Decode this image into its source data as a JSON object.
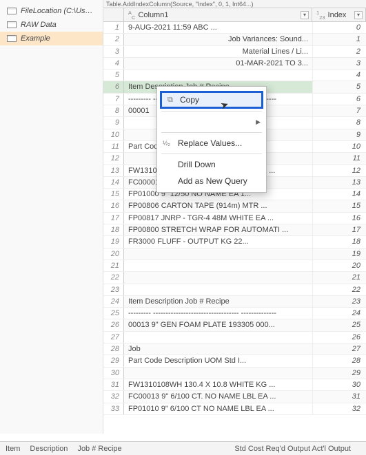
{
  "nav": {
    "items": [
      {
        "label": "FileLocation (C:\\Users\\lisde..."
      },
      {
        "label": "RAW Data"
      },
      {
        "label": "Example"
      }
    ]
  },
  "fx": "Table.AddIndexColumn(Source, \"Index\", 0, 1, Int64...)",
  "columns": {
    "col1": {
      "type_prefix": "A",
      "type_suffix": "C",
      "label": "Column1"
    },
    "col2": {
      "type_prefix": "1",
      "type_suffix": "23",
      "label": "Index"
    }
  },
  "rows": [
    {
      "n": 1,
      "c1": "9-AUG-2021 11:59                                   ABC ...",
      "idx": 0
    },
    {
      "n": 2,
      "c1": "Job Variances: Sound...",
      "idx": 1,
      "align": "right"
    },
    {
      "n": 3,
      "c1": "Material Lines / Li...",
      "idx": 2,
      "align": "right"
    },
    {
      "n": 4,
      "c1": "01-MAR-2021 TO 3...",
      "idx": 3,
      "align": "right"
    },
    {
      "n": 5,
      "c1": "",
      "idx": 4
    },
    {
      "n": 6,
      "c1": "Item       Description            Job #  Recipe",
      "idx": 5
    },
    {
      "n": 7,
      "c1": "---------   ----------------------------------   --------------",
      "idx": 6
    },
    {
      "n": 8,
      "c1": "00001",
      "idx": 7
    },
    {
      "n": 9,
      "c1": "",
      "idx": 8
    },
    {
      "n": 10,
      "c1": "",
      "idx": 9
    },
    {
      "n": 11,
      "c1": "   Part Code",
      "idx": 10
    },
    {
      "n": 12,
      "c1": "",
      "idx": 11
    },
    {
      "n": 13,
      "c1": "   FW1310108WH  130.4 X 10.8        WHITE KG   ...",
      "idx": 12
    },
    {
      "n": 14,
      "c1": "   FC00001      9\" 12/50 CT. NO NAME      EA",
      "idx": 13
    },
    {
      "n": 15,
      "c1": "   FP01000      9\" 12/50 NO NAME          EA     1...",
      "idx": 14
    },
    {
      "n": 16,
      "c1": "   FP00806      CARTON TAPE (914m)        MTR   ...",
      "idx": 15
    },
    {
      "n": 17,
      "c1": "   FP00817      JNRP - TGR-4 48M WHITE    EA    ...",
      "idx": 16
    },
    {
      "n": 18,
      "c1": "   FP00800      STRETCH WRAP FOR AUTOMATI ...",
      "idx": 17
    },
    {
      "n": 19,
      "c1": "   FR3000       FLUFF - OUTPUT            KG     22...",
      "idx": 18
    },
    {
      "n": 20,
      "c1": "",
      "idx": 19
    },
    {
      "n": 21,
      "c1": "",
      "idx": 20
    },
    {
      "n": 22,
      "c1": "",
      "idx": 21
    },
    {
      "n": 23,
      "c1": "",
      "idx": 22
    },
    {
      "n": 24,
      "c1": "Item       Description            Job #  Recipe",
      "idx": 23
    },
    {
      "n": 25,
      "c1": "---------   ----------------------------------   --------------",
      "idx": 24
    },
    {
      "n": 26,
      "c1": "00013    9\" GEN FOAM PLATE         193305 000...",
      "idx": 25
    },
    {
      "n": 27,
      "c1": "",
      "idx": 26
    },
    {
      "n": 28,
      "c1": "                                     Job",
      "idx": 27
    },
    {
      "n": 29,
      "c1": "   Part Code   Description            UOM    Std I...",
      "idx": 28
    },
    {
      "n": 30,
      "c1": "",
      "idx": 29
    },
    {
      "n": 31,
      "c1": "   FW1310108WH  130.4 X 10.8        WHITE KG   ...",
      "idx": 30
    },
    {
      "n": 32,
      "c1": "   FC00013      9\" 6/100 CT. NO NAME LBL  EA    ...",
      "idx": 31
    },
    {
      "n": 33,
      "c1": "   FP01010      9\" 6/100 CT NO NAME LBL   EA    ...",
      "idx": 32
    }
  ],
  "context_menu": {
    "copy": "Copy",
    "replace_values": "Replace Values...",
    "drill_down": "Drill Down",
    "add_as_new_query": "Add as New Query"
  },
  "status": {
    "item": "Item",
    "description": "Description",
    "job_recipe": "Job #  Recipe",
    "std_cost": "Std Cost Req'd Output Act'l Output"
  }
}
